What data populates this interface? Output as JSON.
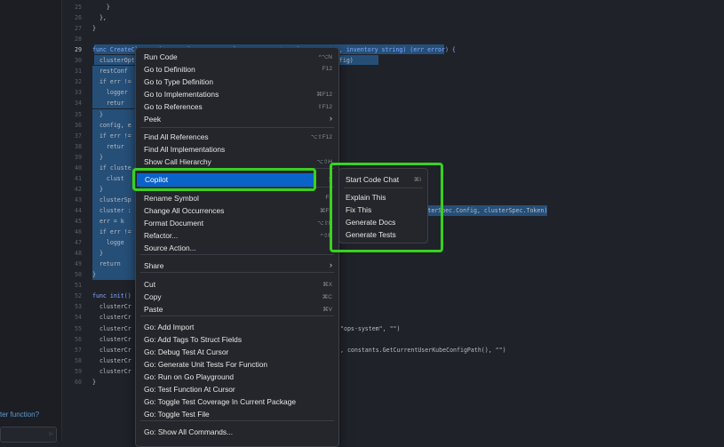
{
  "chat": {
    "prompt": "ter function?",
    "send_icon": "send-icon"
  },
  "code": [
    {
      "n": "25",
      "t": "    }"
    },
    {
      "n": "26",
      "t": "  },"
    },
    {
      "n": "27",
      "t": "}"
    },
    {
      "n": "28",
      "t": ""
    },
    {
      "n": "29",
      "t": "func CreateCluster(logger *log.Logger, clusterOpt option.ClusterOption, inventory string) (err error) {"
    },
    {
      "n": "30",
      "t": "  clusterOpt.Kubeconfig = utils.GetAbsoluteFilePath(clusterOpt.Kubeconfig)"
    },
    {
      "n": "31",
      "t": "  restConf"
    },
    {
      "n": "32",
      "t": "  if err !="
    },
    {
      "n": "33",
      "t": "    logger"
    },
    {
      "n": "34",
      "t": "    retur"
    },
    {
      "n": "35",
      "t": "  }"
    },
    {
      "n": "36",
      "t": "  config, e"
    },
    {
      "n": "37",
      "t": "  if err !="
    },
    {
      "n": "38",
      "t": "    retur"
    },
    {
      "n": "39",
      "t": "  }"
    },
    {
      "n": "40",
      "t": "  if cluste"
    },
    {
      "n": "41",
      "t": "    clust"
    },
    {
      "n": "42",
      "t": "  }"
    },
    {
      "n": "43",
      "t": "  clusterSp"
    },
    {
      "n": "44",
      "t": "  cluster :"
    },
    {
      "n": "45",
      "t": "  err = k"
    },
    {
      "n": "46",
      "t": "  if err !="
    },
    {
      "n": "47",
      "t": "    logge"
    },
    {
      "n": "48",
      "t": "  }"
    },
    {
      "n": "49",
      "t": "  return"
    },
    {
      "n": "50",
      "t": "}"
    },
    {
      "n": "51",
      "t": ""
    },
    {
      "n": "52",
      "t": "func init() {"
    },
    {
      "n": "53",
      "t": "  clusterCr"
    },
    {
      "n": "54",
      "t": "  clusterCr"
    },
    {
      "n": "55",
      "t": "  clusterCr"
    },
    {
      "n": "56",
      "t": "  clusterCr"
    },
    {
      "n": "57",
      "t": "  clusterCr"
    },
    {
      "n": "58",
      "t": "  clusterCr"
    },
    {
      "n": "59",
      "t": "  clusterCr"
    },
    {
      "n": "60",
      "t": "}"
    }
  ],
  "code_overflow": {
    "line44": "sterSpec.Server, clusterSpec.Config, clusterSpec.Token)",
    "line55": "\"ops-system\", \"\")",
    "line57": ", constants.GetCurrentUserKubeConfigPath(), \"\")"
  },
  "menu": [
    {
      "label": "Run Code",
      "shortcut": "^⌥N"
    },
    {
      "label": "Go to Definition",
      "shortcut": "F12"
    },
    {
      "label": "Go to Type Definition",
      "shortcut": ""
    },
    {
      "label": "Go to Implementations",
      "shortcut": "⌘F12"
    },
    {
      "label": "Go to References",
      "shortcut": "⇧F12"
    },
    {
      "label": "Peek",
      "shortcut": "",
      "submenu": true
    },
    {
      "label": "Find All References",
      "shortcut": "⌥⇧F12"
    },
    {
      "label": "Find All Implementations",
      "shortcut": ""
    },
    {
      "label": "Show Call Hierarchy",
      "shortcut": "⌥⇧H"
    },
    {
      "label": "Copilot",
      "shortcut": "",
      "submenu": true,
      "active": true
    },
    {
      "label": "Rename Symbol",
      "shortcut": "F2"
    },
    {
      "label": "Change All Occurrences",
      "shortcut": "⌘F2"
    },
    {
      "label": "Format Document",
      "shortcut": "⌥⇧F"
    },
    {
      "label": "Refactor...",
      "shortcut": "^⇧R"
    },
    {
      "label": "Source Action...",
      "shortcut": ""
    },
    {
      "label": "Share",
      "shortcut": "",
      "submenu": true
    },
    {
      "label": "Cut",
      "shortcut": "⌘X"
    },
    {
      "label": "Copy",
      "shortcut": "⌘C"
    },
    {
      "label": "Paste",
      "shortcut": "⌘V"
    },
    {
      "label": "Go: Add Import",
      "shortcut": ""
    },
    {
      "label": "Go: Add Tags To Struct Fields",
      "shortcut": ""
    },
    {
      "label": "Go: Debug Test At Cursor",
      "shortcut": ""
    },
    {
      "label": "Go: Generate Unit Tests For Function",
      "shortcut": ""
    },
    {
      "label": "Go: Run on Go Playground",
      "shortcut": ""
    },
    {
      "label": "Go: Test Function At Cursor",
      "shortcut": ""
    },
    {
      "label": "Go: Toggle Test Coverage In Current Package",
      "shortcut": ""
    },
    {
      "label": "Go: Toggle Test File",
      "shortcut": ""
    },
    {
      "label": "Go: Show All Commands...",
      "shortcut": ""
    }
  ],
  "submenu": [
    {
      "label": "Start Code Chat",
      "shortcut": "⌘I"
    },
    {
      "label": "Explain This",
      "shortcut": ""
    },
    {
      "label": "Fix This",
      "shortcut": ""
    },
    {
      "label": "Generate Docs",
      "shortcut": ""
    },
    {
      "label": "Generate Tests",
      "shortcut": ""
    }
  ],
  "colors": {
    "highlight": "#39d11e",
    "active": "#0a63c9",
    "selection": "#264f78"
  }
}
